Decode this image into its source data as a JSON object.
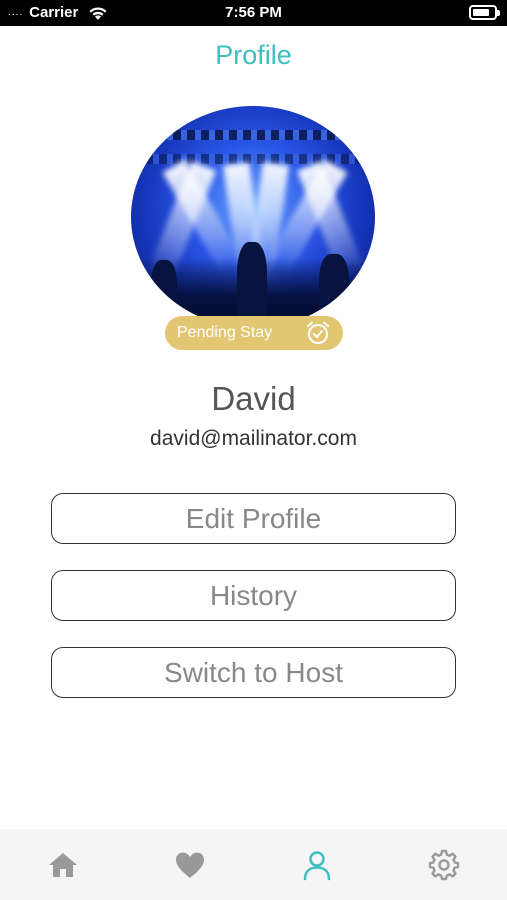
{
  "status_bar": {
    "signal": "....",
    "carrier": "Carrier",
    "time": "7:56 PM",
    "battery_level": 0.8
  },
  "header": {
    "title": "Profile"
  },
  "profile": {
    "status_badge": "Pending Stay",
    "name": "David",
    "email": "david@mailinator.com"
  },
  "actions": {
    "edit_profile": "Edit Profile",
    "history": "History",
    "switch_to_host": "Switch to Host"
  },
  "tab_bar": {
    "active": "profile",
    "items": [
      {
        "id": "home",
        "icon": "home-icon"
      },
      {
        "id": "favorites",
        "icon": "heart-icon"
      },
      {
        "id": "profile",
        "icon": "user-icon"
      },
      {
        "id": "settings",
        "icon": "gear-icon"
      }
    ]
  },
  "colors": {
    "accent": "#3dbfbf",
    "badge": "#e3c672",
    "inactive_icon": "#999999"
  }
}
